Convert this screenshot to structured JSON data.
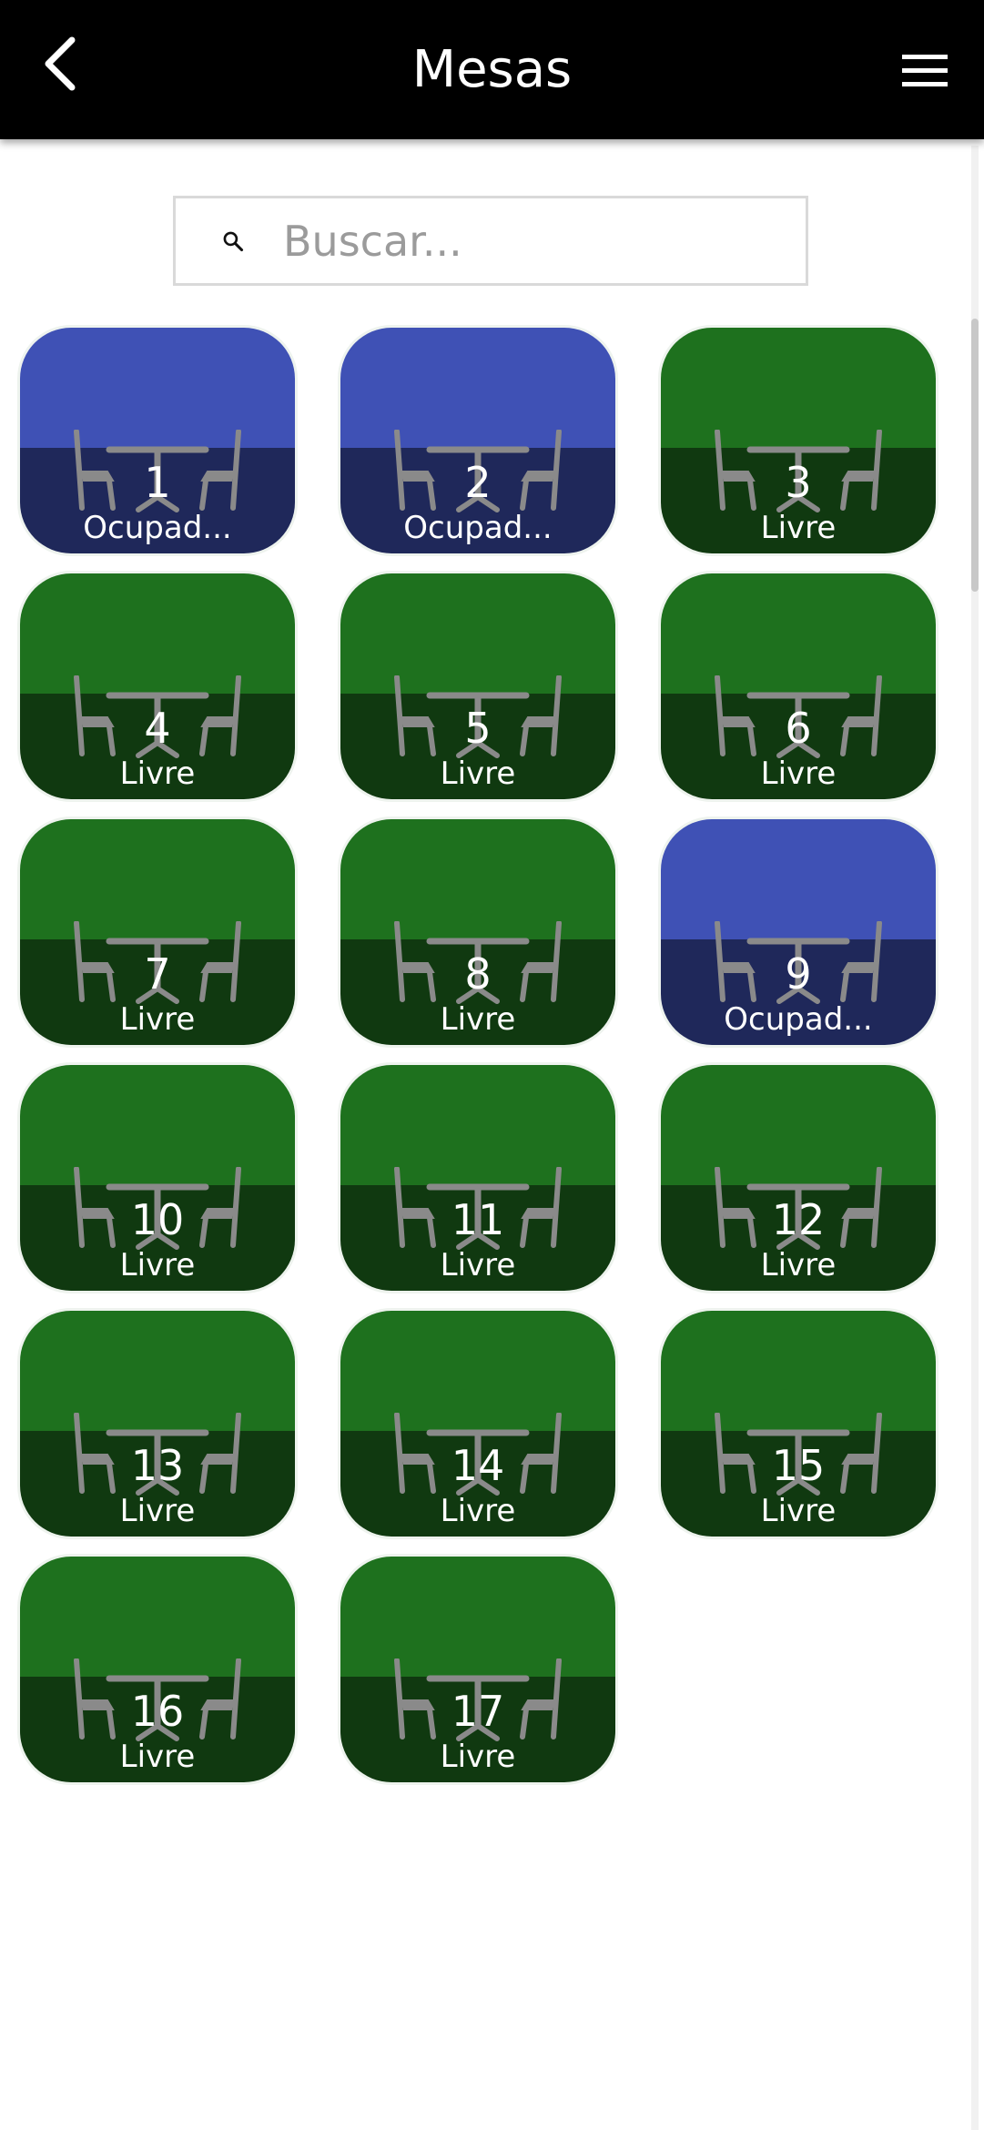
{
  "header": {
    "title": "Mesas",
    "back_icon": "chevron-left-icon",
    "menu_icon": "hamburger-menu-icon"
  },
  "search": {
    "placeholder": "Buscar...",
    "value": "",
    "icon": "search-icon"
  },
  "colors": {
    "free_top": "#1e711e",
    "free_bottom": "#103910",
    "busy_top": "#3f51b5",
    "busy_bottom": "#1f285a"
  },
  "tables": [
    {
      "number": "1",
      "status": "Ocupad...",
      "state": "busy"
    },
    {
      "number": "2",
      "status": "Ocupad...",
      "state": "busy"
    },
    {
      "number": "3",
      "status": "Livre",
      "state": "free"
    },
    {
      "number": "4",
      "status": "Livre",
      "state": "free"
    },
    {
      "number": "5",
      "status": "Livre",
      "state": "free"
    },
    {
      "number": "6",
      "status": "Livre",
      "state": "free"
    },
    {
      "number": "7",
      "status": "Livre",
      "state": "free"
    },
    {
      "number": "8",
      "status": "Livre",
      "state": "free"
    },
    {
      "number": "9",
      "status": "Ocupad...",
      "state": "busy"
    },
    {
      "number": "10",
      "status": "Livre",
      "state": "free"
    },
    {
      "number": "11",
      "status": "Livre",
      "state": "free"
    },
    {
      "number": "12",
      "status": "Livre",
      "state": "free"
    },
    {
      "number": "13",
      "status": "Livre",
      "state": "free"
    },
    {
      "number": "14",
      "status": "Livre",
      "state": "free"
    },
    {
      "number": "15",
      "status": "Livre",
      "state": "free"
    },
    {
      "number": "16",
      "status": "Livre",
      "state": "free"
    },
    {
      "number": "17",
      "status": "Livre",
      "state": "free"
    }
  ]
}
